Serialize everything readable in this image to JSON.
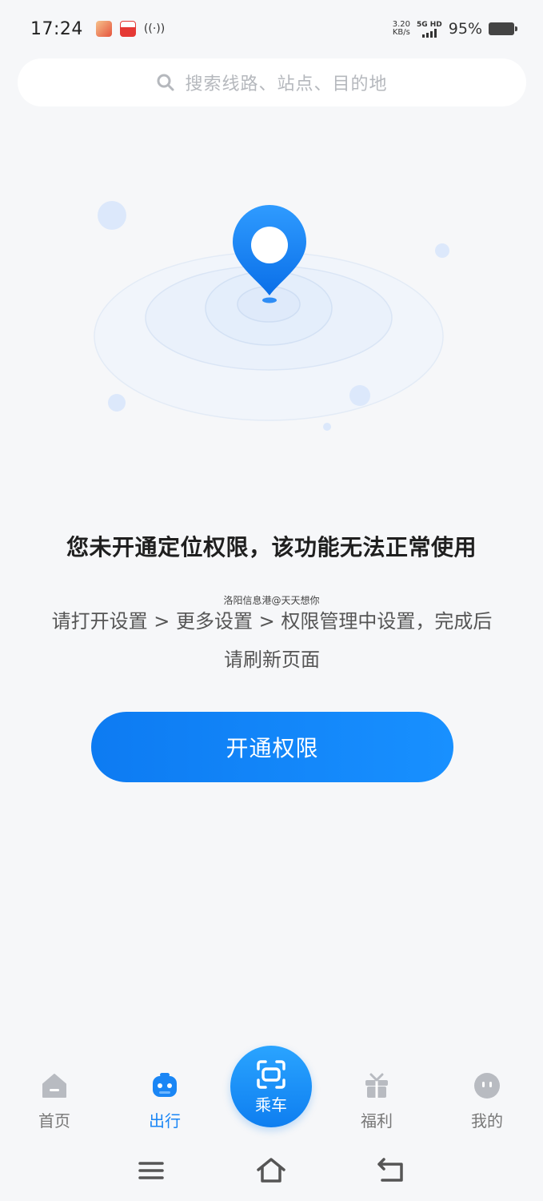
{
  "status_bar": {
    "time": "17:24",
    "net_speed_value": "3.20",
    "net_speed_unit": "KB/s",
    "signal_label": "5G HD",
    "battery": "95%"
  },
  "search": {
    "placeholder": "搜索线路、站点、目的地"
  },
  "message": {
    "title": "您未开通定位权限，该功能无法正常使用",
    "watermark": "洛阳信息港@天天想你",
    "desc_line1": "请打开设置 > 更多设置 > 权限管理中设置，完成后",
    "desc_line2": "请刷新页面"
  },
  "button": {
    "open_label": "开通权限"
  },
  "tabs": [
    {
      "label": "首页",
      "icon": "home-icon"
    },
    {
      "label": "出行",
      "icon": "bus-icon",
      "active": true
    },
    {
      "label": "乘车",
      "icon": "scan-icon"
    },
    {
      "label": "福利",
      "icon": "gift-icon"
    },
    {
      "label": "我的",
      "icon": "profile-icon"
    }
  ],
  "colors": {
    "accent": "#1890ff",
    "background": "#f6f7f9"
  }
}
